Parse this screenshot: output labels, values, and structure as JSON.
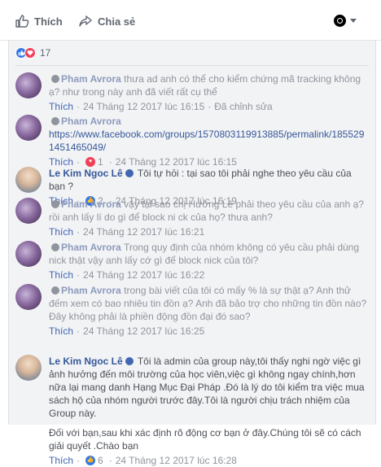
{
  "action_bar": {
    "like_label": "Thích",
    "share_label": "Chia sẻ"
  },
  "reactions": {
    "count": "17"
  },
  "comments": [
    {
      "author": "Pham Avrora",
      "text": "thưa ad anh có thể cho kiểm chứng mã tracking không ạ? như trong này anh đã viết rất cụ thể",
      "like": "Thích",
      "time": "24 Tháng 12 2017 lúc 16:15",
      "edited": "Đã chỉnh sửa"
    },
    {
      "author": "Pham Avrora",
      "link": "https://www.facebook.com/groups/1570803119913885/permalink/1855291451465049/",
      "like": "Thích",
      "react_count": "1",
      "time": "24 Tháng 12 2017 lúc 16:15"
    },
    {
      "author": "Le Kim Ngoc Lê",
      "text": "Tôi tự hỏi : tại sao tôi phải nghe theo yêu cầu của bạn ?",
      "like": "Thích",
      "react_count": "2",
      "time": "24 Tháng 12 2017 lúc 16:19"
    },
    {
      "author": "Pham Avrora",
      "text": "vậy tại sao chị Hường Lê phải theo yêu cầu của anh ạ? rồi anh lấy lí do gì để block ni ck của họ? thưa anh?",
      "like": "Thích",
      "time": "24 Tháng 12 2017 lúc 16:21"
    },
    {
      "author": "Pham Avrora",
      "text": "Trong quy định của nhóm không có yêu cầu phải dùng nick thật vậy anh lấy cớ gì để block nick của tôi?",
      "like": "Thích",
      "time": "24 Tháng 12 2017 lúc 16:22"
    },
    {
      "author": "Pham Avrora",
      "text": "trong bài viết của tôi có mấy % là sự thật ạ? Anh thử đếm xem có bao nhiêu tin đồn ạ? Anh đã bảo trợ cho những tin đồn nào? Đây không phải là phiền động đồn đại đó sao?",
      "like": "Thích",
      "time": "24 Tháng 12 2017 lúc 16:25"
    },
    {
      "author": "Le Kim Ngoc Lê",
      "text": "Tôi là admin của group này,tôi thấy nghi ngờ việc gì ảnh hưởng đến môi trường của học viên,việc gì không ngay chính,hơn nữa lại mang danh Hạng Mục Đại Pháp .Đó là lý do tôi kiểm tra việc mua sách hộ của nhóm người trước đây.Tôi là người chịu trách nhiệm của Group này.",
      "text2": "Đối với bạn,sau khi xác định rõ động cơ bạn ở đây.Chúng tôi sẽ có cách giải quyết .Chào bạn",
      "like": "Thích",
      "react_count": "6",
      "time": "24 Tháng 12 2017 lúc 16:28"
    }
  ],
  "colors": {
    "link_blue": "#365899",
    "panel_bg": "#f2f3f5",
    "love_red": "#f33e58",
    "like_blue": "#3578e5"
  }
}
